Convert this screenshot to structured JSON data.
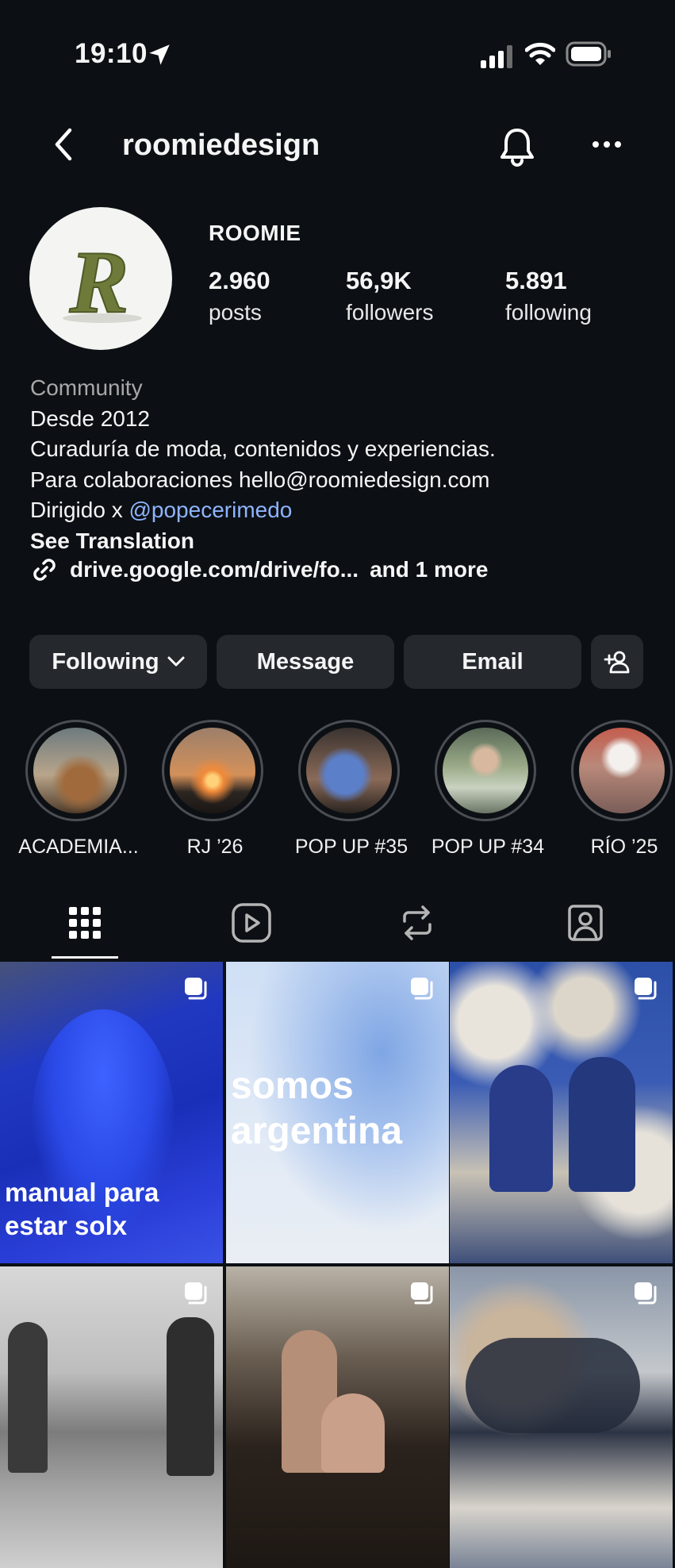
{
  "status_bar": {
    "time": "19:10"
  },
  "header": {
    "username": "roomiedesign"
  },
  "profile": {
    "name": "ROOMIE",
    "stats": [
      {
        "value": "2.960",
        "label": "posts"
      },
      {
        "value": "56,9K",
        "label": "followers"
      },
      {
        "value": "5.891",
        "label": "following"
      }
    ],
    "category": "Community",
    "bio_lines": [
      "Desde 2012",
      "Curaduría de moda, contenidos y experiencias.",
      "Para colaboraciones hello@roomiedesign.com"
    ],
    "directed_prefix": "Dirigido x ",
    "mention": "@popecerimedo",
    "see_translation": "See Translation",
    "link": "drive.google.com/drive/fo...",
    "link_more": "and 1 more"
  },
  "actions": {
    "following": "Following",
    "message": "Message",
    "email": "Email"
  },
  "highlights": [
    {
      "label": "ACADEMIA..."
    },
    {
      "label": "RJ ’26"
    },
    {
      "label": "POP UP #35"
    },
    {
      "label": "POP UP #34"
    },
    {
      "label": "RÍO ’25"
    }
  ],
  "tabs": [
    "grid-icon",
    "reels-icon",
    "reposts-icon",
    "tagged-icon"
  ],
  "posts": [
    {
      "overlay": "manual para\nestar solx"
    },
    {
      "overlay": "somos\nargentina"
    },
    {
      "overlay": ""
    },
    {
      "overlay": ""
    },
    {
      "overlay": ""
    },
    {
      "overlay": ""
    }
  ],
  "colors": {
    "background": "#0c1014",
    "button": "#25292e",
    "link": "#8fb4ff",
    "muted": "#a8a8a8"
  }
}
